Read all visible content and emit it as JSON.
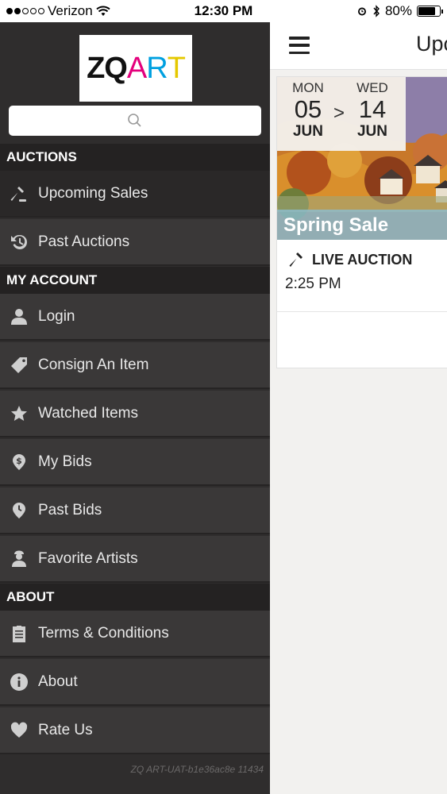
{
  "status_bar": {
    "carrier": "Verizon",
    "time": "12:30 PM",
    "battery": "80%",
    "battery_level": 0.8
  },
  "sidebar": {
    "logo": "ZQART",
    "search": {
      "placeholder": "",
      "icon": "search-icon"
    },
    "sections": {
      "auctions": "AUCTIONS",
      "my_account": "MY ACCOUNT",
      "about": "ABOUT"
    },
    "items": {
      "upcoming_sales": {
        "label": "Upcoming Sales",
        "icon": "gavel-icon"
      },
      "past_auctions": {
        "label": "Past Auctions",
        "icon": "history-icon"
      },
      "login": {
        "label": "Login",
        "icon": "user-icon"
      },
      "consign": {
        "label": "Consign An Item",
        "icon": "tag-icon"
      },
      "watched": {
        "label": "Watched Items",
        "icon": "star-icon"
      },
      "my_bids": {
        "label": "My Bids",
        "icon": "dollar-pin-icon"
      },
      "past_bids": {
        "label": "Past Bids",
        "icon": "clock-pin-icon"
      },
      "favorite_artists": {
        "label": "Favorite Artists",
        "icon": "artist-icon"
      },
      "terms": {
        "label": "Terms & Conditions",
        "icon": "clipboard-icon"
      },
      "about": {
        "label": "About",
        "icon": "info-icon"
      },
      "rate_us": {
        "label": "Rate Us",
        "icon": "heart-icon"
      }
    },
    "version": "ZQ ART-UAT-b1e36ac8e 11434"
  },
  "main": {
    "title": "Upc",
    "card": {
      "start": {
        "dow": "MON",
        "day": "05",
        "month": "JUN"
      },
      "arrow": ">",
      "end": {
        "dow": "WED",
        "day": "14",
        "month": "JUN"
      },
      "sale_name": "Spring Sale",
      "auction_type": "LIVE AUCTION",
      "time": "2:25 PM"
    }
  }
}
